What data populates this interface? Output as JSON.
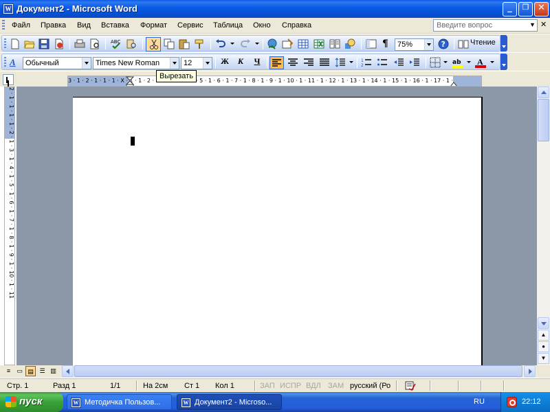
{
  "window": {
    "title": "Документ2 - Microsoft Word",
    "app_icon_letter": "W",
    "controls": {
      "minimize": "_",
      "maximize": "❐",
      "close": "✕"
    }
  },
  "menubar": {
    "items": [
      "Файл",
      "Правка",
      "Вид",
      "Вставка",
      "Формат",
      "Сервис",
      "Таблица",
      "Окно",
      "Справка"
    ],
    "help_placeholder": "Введите вопрос",
    "close_label": "✕"
  },
  "toolbar_standard": {
    "icons": [
      "new-document-icon",
      "open-icon",
      "save-icon",
      "permission-icon",
      "print-icon",
      "print-preview-icon",
      "spelling-icon",
      "research-icon",
      "cut-icon",
      "copy-icon",
      "paste-icon",
      "format-painter-icon",
      "undo-icon",
      "redo-icon",
      "hyperlink-icon",
      "tables-borders-icon",
      "insert-table-icon",
      "insert-excel-icon",
      "columns-icon",
      "drawing-icon",
      "document-map-icon",
      "show-formatting-icon",
      "help-icon"
    ],
    "zoom": "75%",
    "read_label": "Чтение",
    "active_icon": "cut-icon"
  },
  "toolbar_formatting": {
    "style": "Обычный",
    "font": "Times New Roman",
    "size": "12",
    "bold": "Ж",
    "italic": "К",
    "underline": "Ч",
    "alignment_active": "align-left",
    "font_color": "#e00000",
    "highlight_color": "#ffff00"
  },
  "tooltip": "Вырезать",
  "ruler": {
    "ticks": "3 · 1 · 2 · 1 · 1 · 1 · X · 1 · 1 · 2 · 1 · 3 · 1 · 4 · 1 · 5 · 1 · 6 · 1 · 7 · 1 · 8 · 1 · 9 · 1 · 10 · 1 · 11 · 1 · 12 · 1 · 13 · 1 · 14 · 1 · 15 · 1 · 16 · 1 · 17 · 1 ·"
  },
  "vertical_ruler": {
    "ticks": "2 · 1 · 1 · 1 · 1 · 2 · 1 · 3 · 1 · 4 · 1 · 5 · 1 · 6 · 1 · 7 · 1 · 8 · 1 · 9 · 1 · 10 · 1 · 11"
  },
  "statusbar": {
    "page": "Стр. 1",
    "section": "Разд 1",
    "pages": "1/1",
    "at": "На 2см",
    "line": "Ст 1",
    "col": "Кол 1",
    "rec": "ЗАП",
    "trk": "ИСПР",
    "ext": "ВДЛ",
    "ovr": "ЗАМ",
    "language": "русский (Ро"
  },
  "taskbar": {
    "start_label": "пуск",
    "tasks": [
      {
        "label": "Методичка Пользов...",
        "active": false
      },
      {
        "label": "Документ2 - Microso...",
        "active": true
      }
    ],
    "language": "RU",
    "clock": "22:12"
  }
}
